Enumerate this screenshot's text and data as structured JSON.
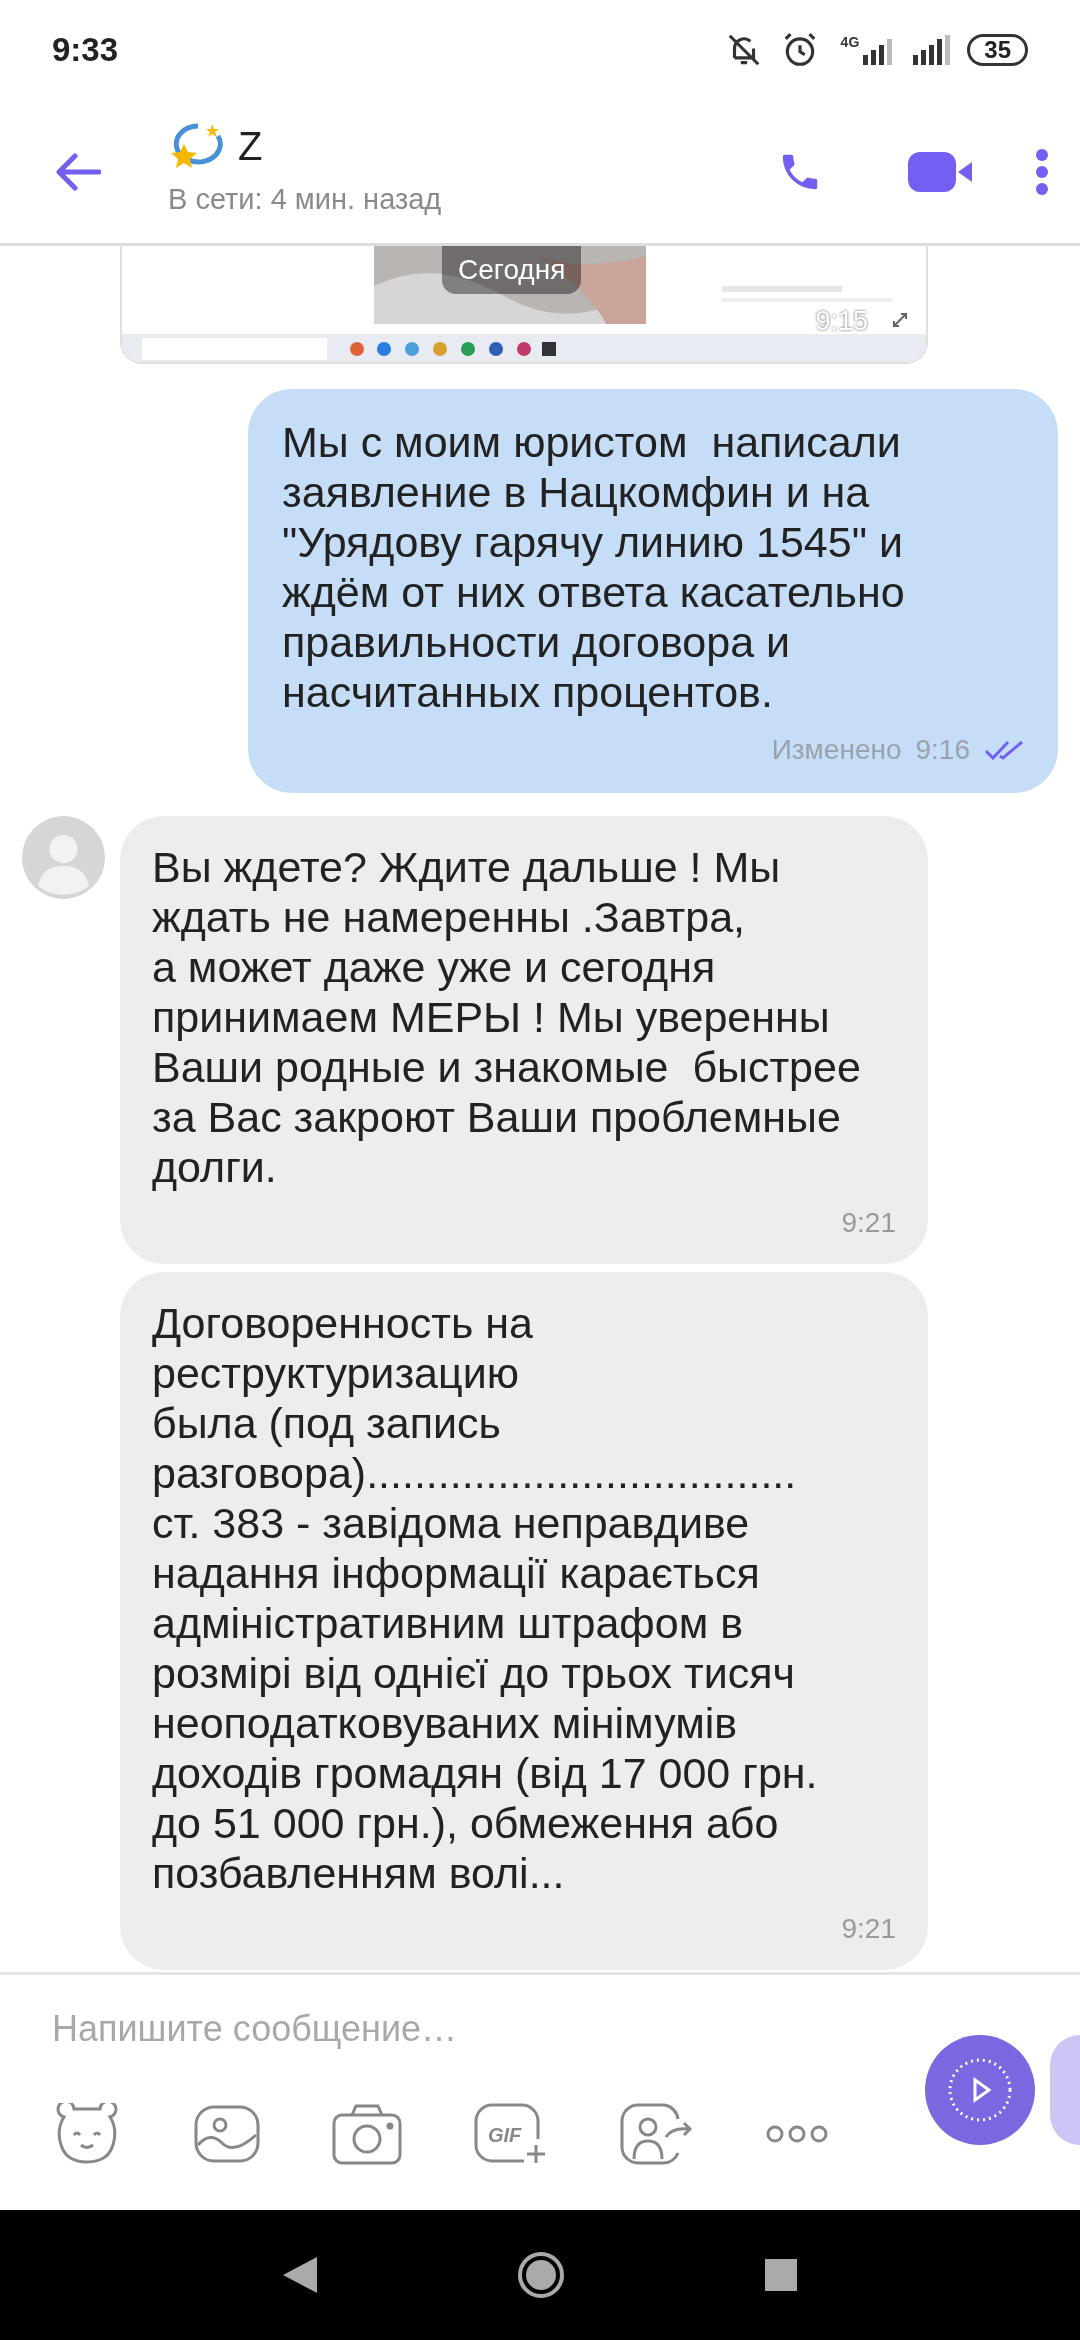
{
  "status_bar": {
    "time": "9:33",
    "network": "4G",
    "battery": "35"
  },
  "header": {
    "name": "Z",
    "presence": "В сети: 4 мин. назад"
  },
  "messages": [
    {
      "date_chip": "Сегодня",
      "time": "9:15"
    },
    {
      "kind": "outgoing",
      "text": "Мы с моим юристом  написали\nзаявление в Нацкомфин и на\n\"Урядову гарячу линию 1545\" и\nждём от них ответа касательно\nправильности договора и\nнасчитанных процентов.",
      "edited_label": "Изменено",
      "time": "9:16",
      "read": true
    },
    {
      "kind": "incoming",
      "show_avatar": true,
      "text": "Вы ждете? Ждите дальше ! Мы\nждать не намеренны .Завтра,\nа может даже уже и сегодня\nпринимаем МЕРЫ ! Мы уверенны\nВаши родные и знакомые  быстрее\nза Вас закроют Ваши проблемные\nдолги.",
      "time": "9:21"
    },
    {
      "kind": "incoming",
      "show_avatar": false,
      "text": "Договоренность на\nреструктуризацию\nбыла (под запись\nразговора)....................................\nст. 383 - завідома неправдиве\nнадання інформації карається\nадміністративним штрафом в\nрозмірі від однієї до трьох тисяч\nнеоподатковуваних мінімумів\nдоходів громадян (від 17 000 грн.\nдо 51 000 грн.), обмеження або\nпозбавленням волі...",
      "time": "9:21"
    }
  ],
  "composer": {
    "placeholder": "Напишите сообщение…",
    "gif_label": "GIF"
  }
}
